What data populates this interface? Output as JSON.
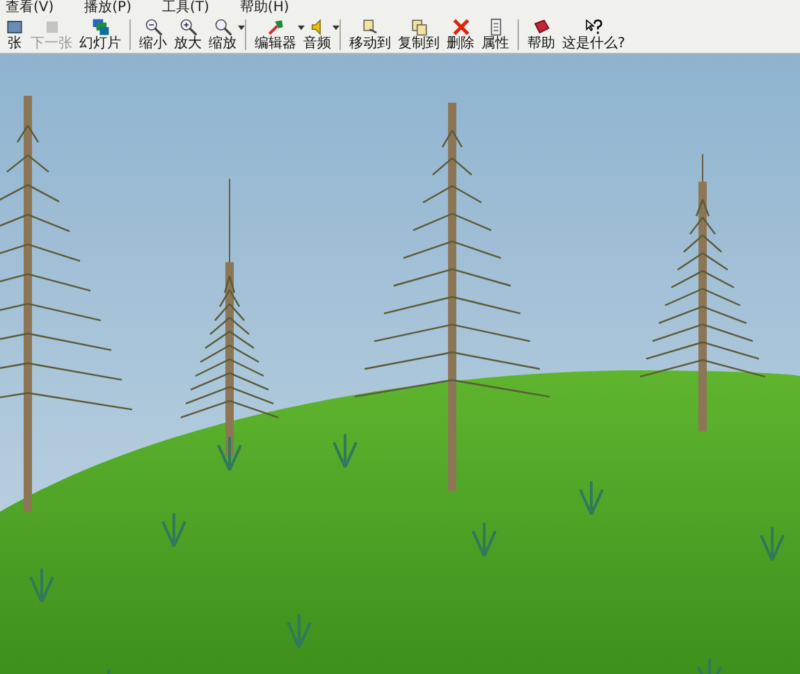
{
  "menu": [
    "查看(V)",
    "播放(P)",
    "工具(T)",
    "帮助(H)"
  ],
  "toolbar": [
    [
      {
        "kind": "prev",
        "label": "张",
        "disabled": false,
        "dropdown": false
      },
      {
        "kind": "next",
        "label": "下一张",
        "disabled": true,
        "dropdown": false
      },
      {
        "kind": "slideshow",
        "label": "幻灯片",
        "disabled": false,
        "dropdown": false
      }
    ],
    [
      {
        "kind": "zoomout",
        "label": "缩小",
        "disabled": false,
        "dropdown": false
      },
      {
        "kind": "zoomin",
        "label": "放大",
        "disabled": false,
        "dropdown": false
      },
      {
        "kind": "zoom",
        "label": "缩放",
        "disabled": false,
        "dropdown": true
      }
    ],
    [
      {
        "kind": "editor",
        "label": "编辑器",
        "disabled": false,
        "dropdown": true
      },
      {
        "kind": "audio",
        "label": "音频",
        "disabled": false,
        "dropdown": true
      }
    ],
    [
      {
        "kind": "move",
        "label": "移动到",
        "disabled": false,
        "dropdown": false
      },
      {
        "kind": "copy",
        "label": "复制到",
        "disabled": false,
        "dropdown": false
      },
      {
        "kind": "delete",
        "label": "删除",
        "disabled": false,
        "dropdown": false
      },
      {
        "kind": "properties",
        "label": "属性",
        "disabled": false,
        "dropdown": false
      }
    ],
    [
      {
        "kind": "help",
        "label": "帮助",
        "disabled": false,
        "dropdown": false
      },
      {
        "kind": "whatsthis",
        "label": "这是什么?",
        "disabled": false,
        "dropdown": false
      }
    ]
  ]
}
